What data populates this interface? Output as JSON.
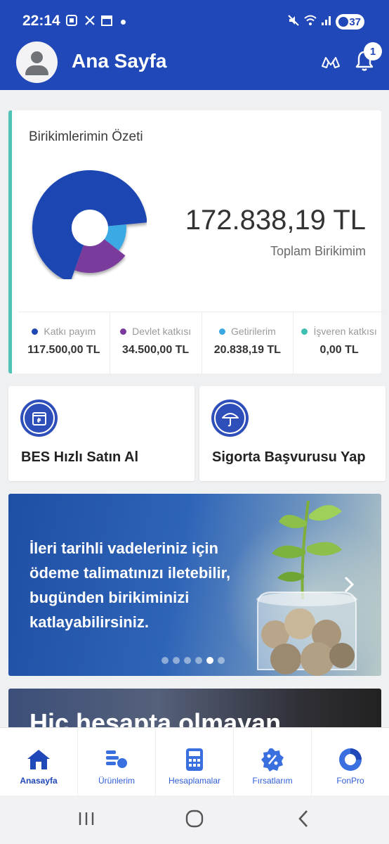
{
  "status_bar": {
    "time": "22:14",
    "battery": "37"
  },
  "header": {
    "title": "Ana Sayfa",
    "notification_count": "1"
  },
  "summary": {
    "title": "Birikimlerimin Özeti",
    "total_amount": "172.838,19 TL",
    "total_label": "Toplam Birikimim",
    "items": [
      {
        "label": "Katkı payım",
        "value": "117.500,00 TL",
        "color": "#1e47b3",
        "amount": 117500.0
      },
      {
        "label": "Devlet katkısı",
        "value": "34.500,00 TL",
        "color": "#7a3a9c",
        "amount": 34500.0
      },
      {
        "label": "Getirilerim",
        "value": "20.838,19 TL",
        "color": "#3aa9e3",
        "amount": 20838.19
      },
      {
        "label": "İşveren katkısı",
        "value": "0,00 TL",
        "color": "#3fbfb2",
        "amount": 0.0
      }
    ]
  },
  "actions": {
    "bes": "BES Hızlı Satın Al",
    "insurance": "Sigorta Başvurusu Yap"
  },
  "banner": {
    "text": "İleri tarihli vadeleriniz için ödeme talimatınızı iletebilir, bugünden birikiminizi katlayabilirsiniz.",
    "slide_count": 6,
    "active_slide": 5
  },
  "banner2": {
    "text": "Hiç hesapta olmayan"
  },
  "bottom_nav": {
    "items": [
      {
        "label": "Anasayfa"
      },
      {
        "label": "Ürünlerim"
      },
      {
        "label": "Hesaplamalar"
      },
      {
        "label": "Fırsatlarım"
      },
      {
        "label": "FonPro"
      }
    ]
  },
  "colors": {
    "brand": "#2148b8",
    "accent": "#4fc3b8"
  }
}
